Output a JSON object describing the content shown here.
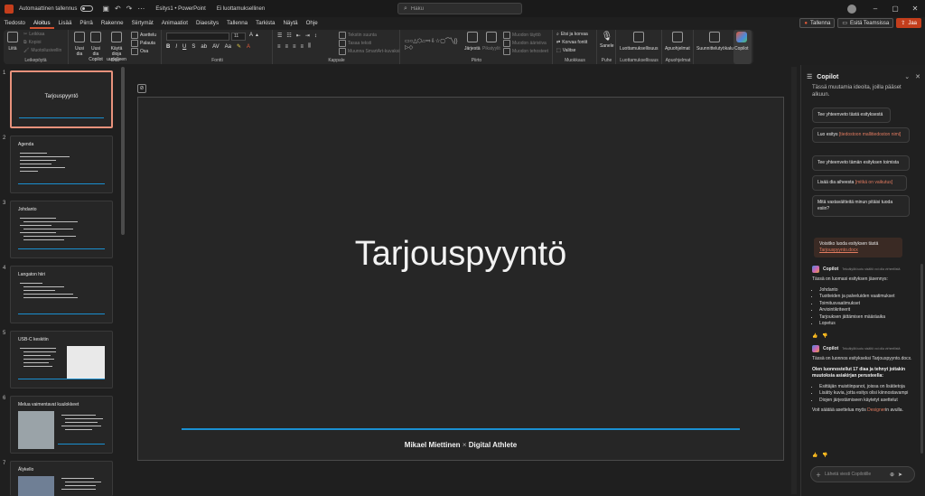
{
  "titlebar": {
    "autosave_label": "Automaattinen tallennus",
    "doc_title": "Esitys1 • PowerPoint",
    "doc_status": "Ei luottamuksellinen",
    "search_placeholder": "Haku",
    "window_controls": [
      "–",
      "▢",
      "✕"
    ]
  },
  "menu": {
    "items": [
      "Tiedosto",
      "Aloitus",
      "Lisää",
      "Piirrä",
      "Rakenne",
      "Siirtymät",
      "Animaatiot",
      "Diaesitys",
      "Tallenna",
      "Tarkista",
      "Näytä",
      "Ohje"
    ],
    "active_index": 1,
    "record_label": "Tallenna",
    "teams_label": "Esitä Teamsissa",
    "share_label": "Jaa"
  },
  "ribbon": {
    "clipboard": {
      "label": "Leikepöytä",
      "paste": "Liitä",
      "cut": "Leikkaa",
      "copy": "Kopioi",
      "format": "Muotoilusivellin"
    },
    "slides": {
      "label": "Diat",
      "new_slide": "Uusi dia",
      "reuse": "Uusi dia Copilot",
      "reuse_slides": "Käytä dioja uudelleen",
      "layout": "Asettelu",
      "reset": "Palauta",
      "section": "Osa"
    },
    "font": {
      "label": "Fontti",
      "size": "11"
    },
    "paragraph": {
      "label": "Kappale",
      "direction": "Tekstin suunta",
      "align": "Tasaa teksti",
      "smartart": "Muunna SmartArt-kuvaksi"
    },
    "drawing": {
      "label": "Piirto",
      "arrange": "Järjestä",
      "quick_styles": "Pikatyylit",
      "fill": "Muodon täyttö",
      "outline": "Muodon ääriviiva",
      "effects": "Muodon tehosteet"
    },
    "editing": {
      "label": "Muokkaus",
      "find": "Etsi ja korvaa",
      "replace": "Korvaa fontit",
      "select": "Valitse"
    },
    "voice": {
      "label": "Puhe",
      "dictate": "Sanele"
    },
    "sensitivity": {
      "label": "Luottamuksellisuus",
      "btn": "Luottamuksellisuus"
    },
    "addins": {
      "label": "Apuohjelmat",
      "btn": "Apuohjelmat"
    },
    "designer": {
      "btn": "Suunnittelutyökalu"
    },
    "copilot": {
      "btn": "Copilot"
    }
  },
  "thumbnails": [
    {
      "num": "1",
      "title": "Tarjouspyyntö",
      "layout": "title",
      "selected": true
    },
    {
      "num": "2",
      "title": "Agenda",
      "layout": "bullets",
      "selected": false
    },
    {
      "num": "3",
      "title": "Johdanto",
      "layout": "bullets",
      "selected": false
    },
    {
      "num": "4",
      "title": "Langaton hiiri",
      "layout": "bullets",
      "selected": false
    },
    {
      "num": "5",
      "title": "USB-C keskitin",
      "layout": "bullets-pic",
      "selected": false
    },
    {
      "num": "6",
      "title": "Melua vaimentavat kuulokkeet",
      "layout": "pic-bullets",
      "selected": false
    },
    {
      "num": "7",
      "title": "Älykello",
      "layout": "pic-bullets",
      "selected": false
    }
  ],
  "slide": {
    "title": "Tarjouspyyntö",
    "footer_name": "Mikael Miettinen",
    "footer_sep": "×",
    "footer_org": "Digital Athlete"
  },
  "copilot": {
    "title": "Copilot",
    "intro": "Tässä muutamia ideoita, joilla pääset alkuun.",
    "suggestions": [
      {
        "text": "Tee yhteenveto tästä esityksestä",
        "hl": ""
      },
      {
        "text": "Luo esitys ",
        "hl": "[tiedostoon mallitiedoston nimi]"
      },
      {
        "text": "Tee yhteenveto tämän esityksen toimista",
        "hl": ""
      },
      {
        "text": "Lisää dia aiheesta ",
        "hl": "[mitkä on vaikutus]"
      },
      {
        "text": "Mitä vastaväitteitä minun pitäisi tuoda esiin?",
        "hl": ""
      }
    ],
    "note_text": "Voisitko luoda esityksen tästä",
    "note_link": "Tarjouspyynto.docx",
    "msg1_meta": "Tekoälyllä luotu sisältö voi olla virheellistä",
    "msg1_intro": "Tässä on luomasi esityksen jäsennys:",
    "msg1_items": [
      "Johdanto",
      "Tuotteiden ja palveluiden vaatimukset",
      "Toimitusvaatimukset",
      "Arviointikriteerit",
      "Tarjouksen jättämisen määräaika",
      "Lopetus"
    ],
    "msg2_meta": "Tekoälyllä luotu sisältö voi olla virheellistä",
    "msg2_intro": "Tässä on luonnos esitykseksi Tarjouspyynto.docx.",
    "msg2_bold": "Olen luonnostellut 17 diaa ja tehnyt joitakin muutoksia asiakirjan perusteella:",
    "msg2_items": [
      "Esittäjän muistiinpanot, joissa on lisätietoja",
      "Lisätty kuvia, jotta esitys olisi kiinnostavampi",
      "Diojen järjestämiseen käytetyt asettelut"
    ],
    "msg2_outro_a": "Voit säätää asettelua myös ",
    "msg2_outro_link": "Designer",
    "msg2_outro_b": "in avulla.",
    "input_placeholder": "Lähetä viesti Copilotille"
  }
}
